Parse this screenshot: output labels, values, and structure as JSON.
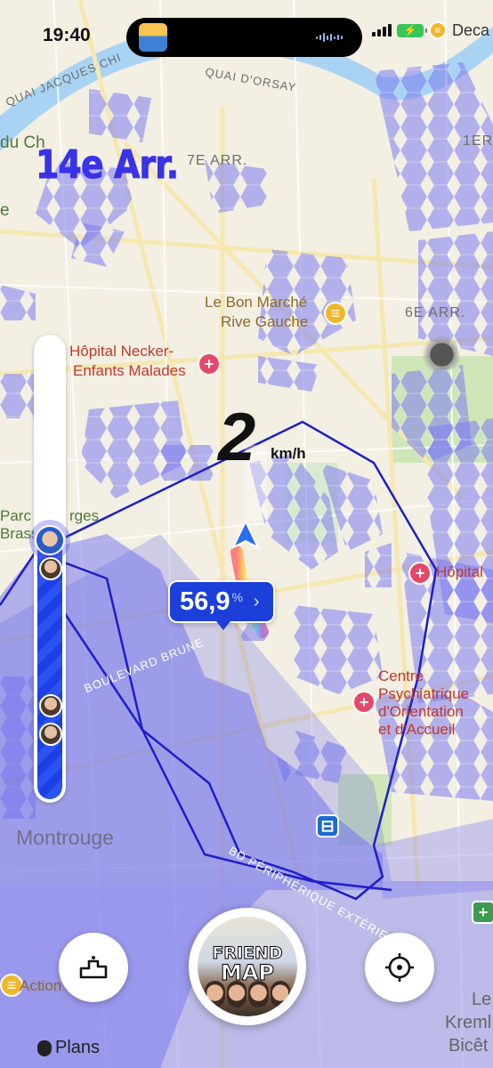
{
  "status_bar": {
    "time": "19:40",
    "app_label": "Deca"
  },
  "map": {
    "district_title": "14e Arr.",
    "area_labels": {
      "arr_7": "7E ARR.",
      "arr_6": "6E ARR.",
      "arr_1": "1ER",
      "montrouge": "Montrouge",
      "kremlin_l1": "Le",
      "kremlin_l2": "Kreml",
      "kremlin_l3": "Bicêt"
    },
    "street_labels": {
      "quai_orsay": "QUAI D'ORSAY",
      "quai_jacques": "QUAI JACQUES CHI",
      "boulevard_brune": "BOULEVARD BRUNE",
      "bd_peripherique": "BD PÉRIPHÉRIQUE EXTÉRIEUR",
      "du_ch": "du Ch",
      "e_left": "e"
    },
    "pois": {
      "bon_marche_l1": "Le Bon Marché",
      "bon_marche_l2": "Rive Gauche",
      "necker_l1": "Hôpital Necker-",
      "necker_l2": "Enfants Malades",
      "hopital_right": "Hôpital",
      "centre_l1": "Centre",
      "centre_l2": "Psychiatrique",
      "centre_l3": "d'Orientation",
      "centre_l4": "et d'Accueil",
      "parc_l1": "Parc",
      "parc_l2": "rges",
      "parc_l3": "Brass",
      "action": "Action"
    },
    "colors": {
      "hex_fill": "#7c7cf0",
      "zone_fill": "#5f5fe8",
      "boundary": "#1e1ec8",
      "park": "#cfe6b8",
      "road": "#f6e7b0"
    }
  },
  "tracker": {
    "speed_value": "2",
    "speed_unit": "km/h",
    "coverage_value": "56,9",
    "coverage_symbol": "%",
    "coverage_chevron": "›",
    "progress_fraction": 0.56
  },
  "bottom_bar": {
    "main_button_line1": "FRIEND",
    "main_button_line2": "MAP",
    "podium_icon": "podium-icon",
    "locate_icon": "crosshair-icon",
    "plans_label": "Plans"
  }
}
